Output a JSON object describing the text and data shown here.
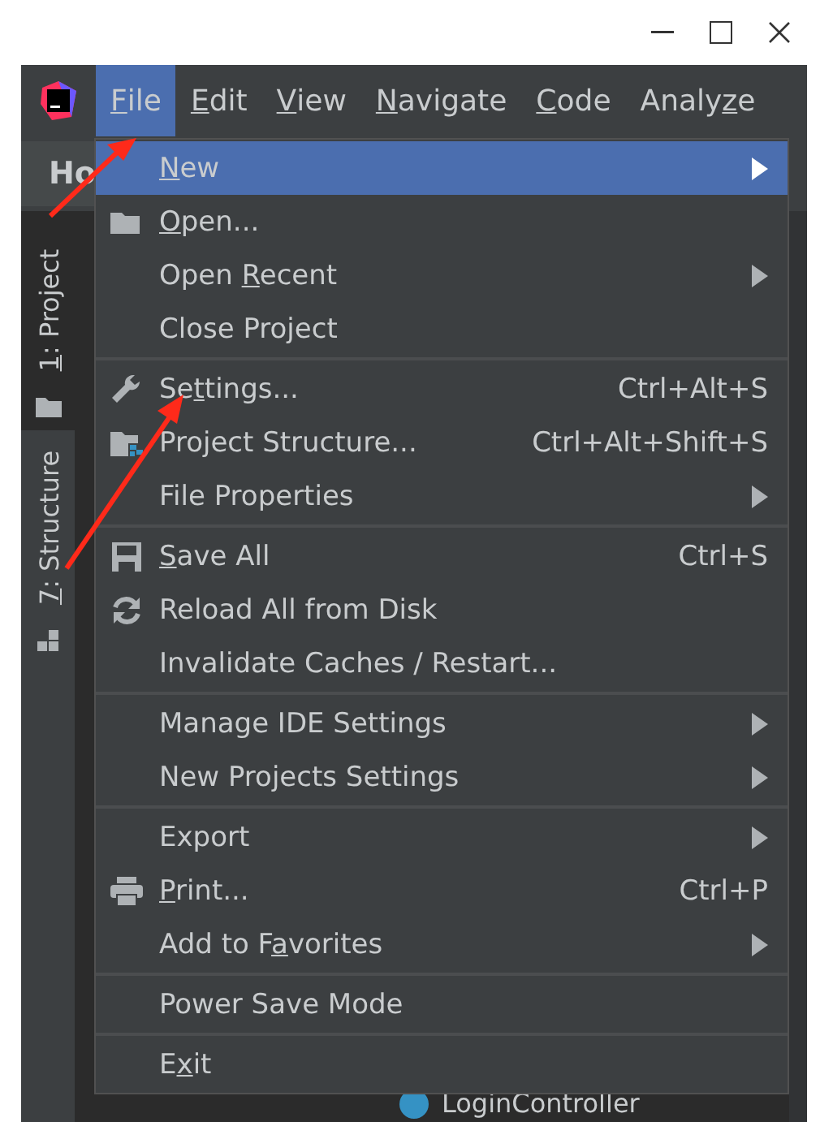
{
  "menu_bar": [
    {
      "parts": [
        {
          "text": "F",
          "underlined": true
        },
        {
          "text": "ile",
          "underlined": false
        }
      ],
      "selected": true
    },
    {
      "parts": [
        {
          "text": "E",
          "underlined": true
        },
        {
          "text": "dit",
          "underlined": false
        }
      ],
      "selected": false
    },
    {
      "parts": [
        {
          "text": "V",
          "underlined": true
        },
        {
          "text": "iew",
          "underlined": false
        }
      ],
      "selected": false
    },
    {
      "parts": [
        {
          "text": "N",
          "underlined": true
        },
        {
          "text": "avigate",
          "underlined": false
        }
      ],
      "selected": false
    },
    {
      "parts": [
        {
          "text": "C",
          "underlined": true
        },
        {
          "text": "ode",
          "underlined": false
        }
      ],
      "selected": false
    },
    {
      "parts": [
        {
          "text": "Analy",
          "underlined": false
        },
        {
          "text": "z",
          "underlined": true
        },
        {
          "text": "e",
          "underlined": false
        }
      ],
      "selected": false
    }
  ],
  "editor_tab": "Ho",
  "tool_strip": [
    {
      "parts": [
        {
          "text": "1",
          "underlined": true
        },
        {
          "text": ": Project",
          "underlined": false
        }
      ],
      "selected": true
    },
    {
      "parts": [
        {
          "text": "7",
          "underlined": true
        },
        {
          "text": ": Structure",
          "underlined": false
        }
      ],
      "selected": false
    }
  ],
  "file_menu": [
    [
      {
        "parts": [
          {
            "text": "N",
            "underlined": true
          },
          {
            "text": "ew",
            "underlined": false
          }
        ],
        "kind": "plain",
        "submenu": true,
        "selected": true
      },
      {
        "parts": [
          {
            "text": "O",
            "underlined": true
          },
          {
            "text": "pen...",
            "underlined": false
          }
        ],
        "kind": "folder",
        "submenu": false,
        "selected": false
      },
      {
        "parts": [
          {
            "text": "Open ",
            "underlined": false
          },
          {
            "text": "R",
            "underlined": true
          },
          {
            "text": "ecent",
            "underlined": false
          }
        ],
        "kind": "plain",
        "submenu": true,
        "selected": false
      },
      {
        "parts": [
          {
            "text": "Close Project",
            "underlined": false
          }
        ],
        "kind": "plain",
        "submenu": false,
        "selected": false
      }
    ],
    [
      {
        "parts": [
          {
            "text": "Se",
            "underlined": false
          },
          {
            "text": "t",
            "underlined": true
          },
          {
            "text": "tings...",
            "underlined": false
          }
        ],
        "kind": "wrench",
        "shortcut": "Ctrl+Alt+S",
        "submenu": false,
        "selected": false
      },
      {
        "parts": [
          {
            "text": "Project Structure...",
            "underlined": false
          }
        ],
        "kind": "project",
        "shortcut": "Ctrl+Alt+Shift+S",
        "submenu": false,
        "selected": false
      },
      {
        "parts": [
          {
            "text": "File Properties",
            "underlined": false
          }
        ],
        "kind": "plain",
        "submenu": true,
        "selected": false
      }
    ],
    [
      {
        "parts": [
          {
            "text": "S",
            "underlined": true
          },
          {
            "text": "ave All",
            "underlined": false
          }
        ],
        "kind": "save",
        "shortcut": "Ctrl+S",
        "submenu": false,
        "selected": false
      },
      {
        "parts": [
          {
            "text": "Reload All from Disk",
            "underlined": false
          }
        ],
        "kind": "reload",
        "submenu": false,
        "selected": false
      },
      {
        "parts": [
          {
            "text": "Invalidate Caches / Restart...",
            "underlined": false
          }
        ],
        "kind": "plain",
        "submenu": false,
        "selected": false
      }
    ],
    [
      {
        "parts": [
          {
            "text": "Manage IDE Settings",
            "underlined": false
          }
        ],
        "kind": "plain",
        "submenu": true,
        "selected": false
      },
      {
        "parts": [
          {
            "text": "New Projects Settings",
            "underlined": false
          }
        ],
        "kind": "plain",
        "submenu": true,
        "selected": false
      }
    ],
    [
      {
        "parts": [
          {
            "text": "Export",
            "underlined": false
          }
        ],
        "kind": "plain",
        "submenu": true,
        "selected": false
      },
      {
        "parts": [
          {
            "text": "P",
            "underlined": true
          },
          {
            "text": "rint...",
            "underlined": false
          }
        ],
        "kind": "print",
        "shortcut": "Ctrl+P",
        "submenu": false,
        "selected": false
      },
      {
        "parts": [
          {
            "text": "Add to F",
            "underlined": false
          },
          {
            "text": "a",
            "underlined": true
          },
          {
            "text": "vorites",
            "underlined": false
          }
        ],
        "kind": "plain",
        "submenu": true,
        "selected": false
      }
    ],
    [
      {
        "parts": [
          {
            "text": "Power Save Mode",
            "underlined": false
          }
        ],
        "kind": "plain",
        "submenu": false,
        "selected": false
      }
    ],
    [
      {
        "parts": [
          {
            "text": "E",
            "underlined": false
          },
          {
            "text": "x",
            "underlined": true
          },
          {
            "text": "it",
            "underlined": false
          }
        ],
        "kind": "plain",
        "submenu": false,
        "selected": false
      }
    ]
  ],
  "bottom_item": "LoginController"
}
